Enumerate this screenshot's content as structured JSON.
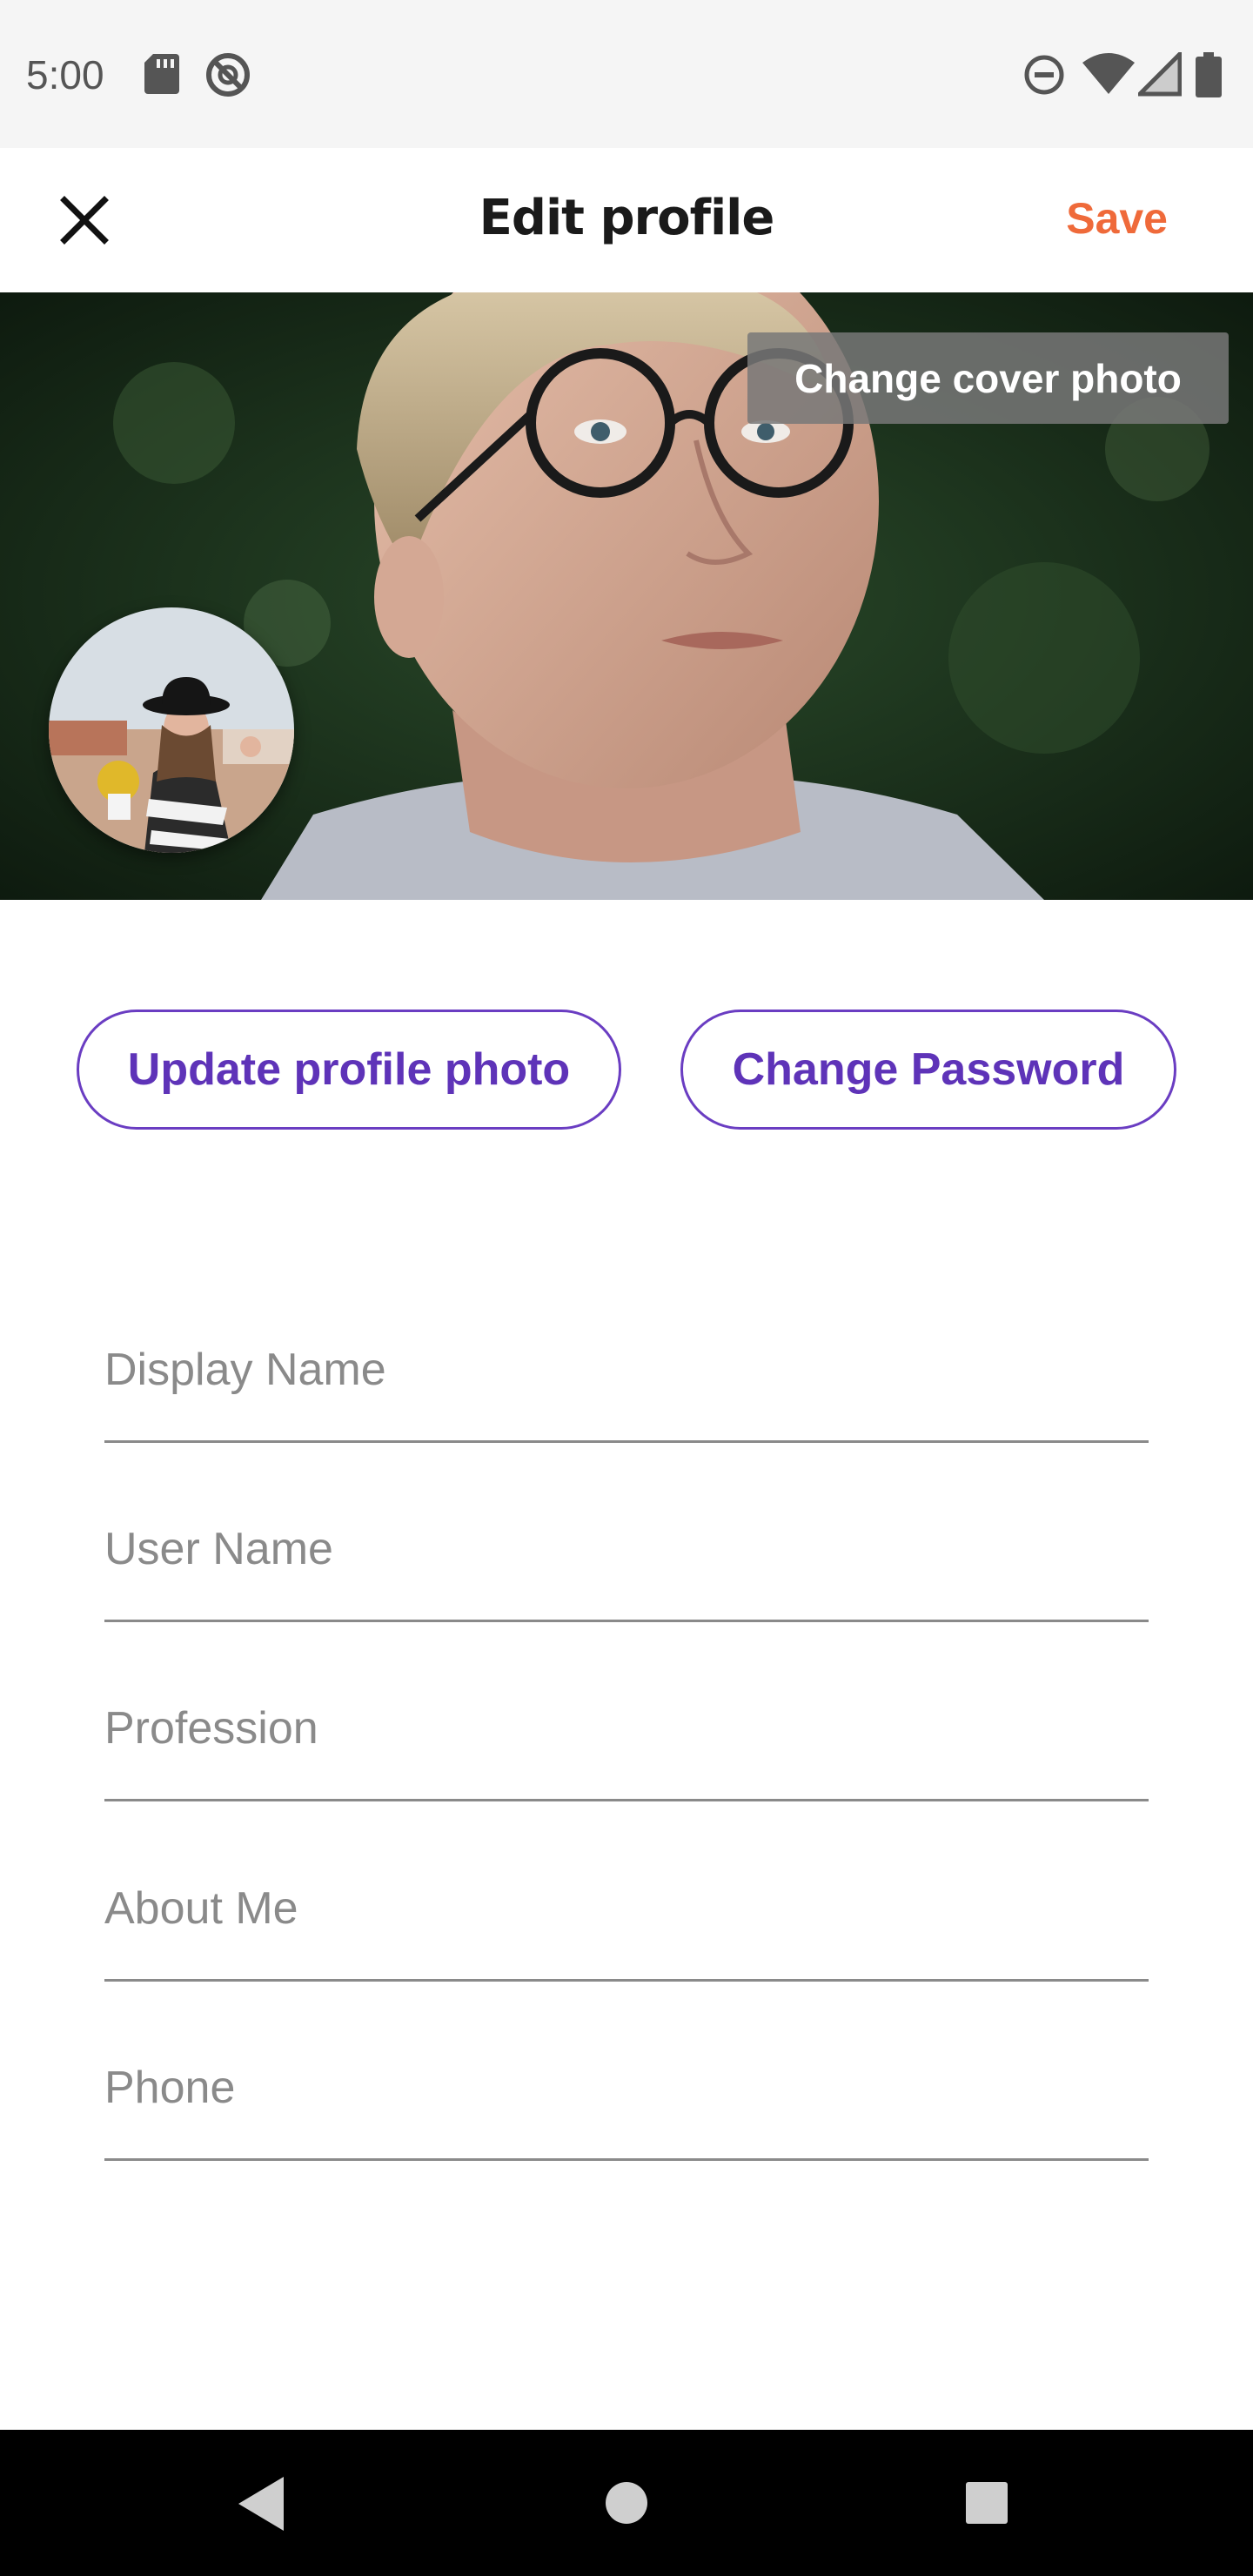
{
  "status_bar": {
    "time": "5:00",
    "icons": [
      "sd-card-icon",
      "no-sync-icon",
      "do-not-disturb-icon",
      "wifi-icon",
      "signal-icon",
      "battery-icon"
    ]
  },
  "header": {
    "close_icon": "close-icon",
    "title": "Edit profile",
    "save_label": "Save"
  },
  "cover": {
    "change_cover_label": "Change cover photo"
  },
  "actions": {
    "update_photo_label": "Update profile photo",
    "change_password_label": "Change Password"
  },
  "form": {
    "fields": [
      {
        "placeholder": "Display Name",
        "value": ""
      },
      {
        "placeholder": "User Name",
        "value": ""
      },
      {
        "placeholder": "Profession",
        "value": ""
      },
      {
        "placeholder": "About Me",
        "value": ""
      },
      {
        "placeholder": "Phone",
        "value": ""
      }
    ]
  },
  "nav_bar": {
    "icons": [
      "back-icon",
      "home-icon",
      "recents-icon"
    ]
  },
  "colors": {
    "accent": "#ef6a3a",
    "primary": "#5e33b8",
    "nav_background": "#000000"
  }
}
